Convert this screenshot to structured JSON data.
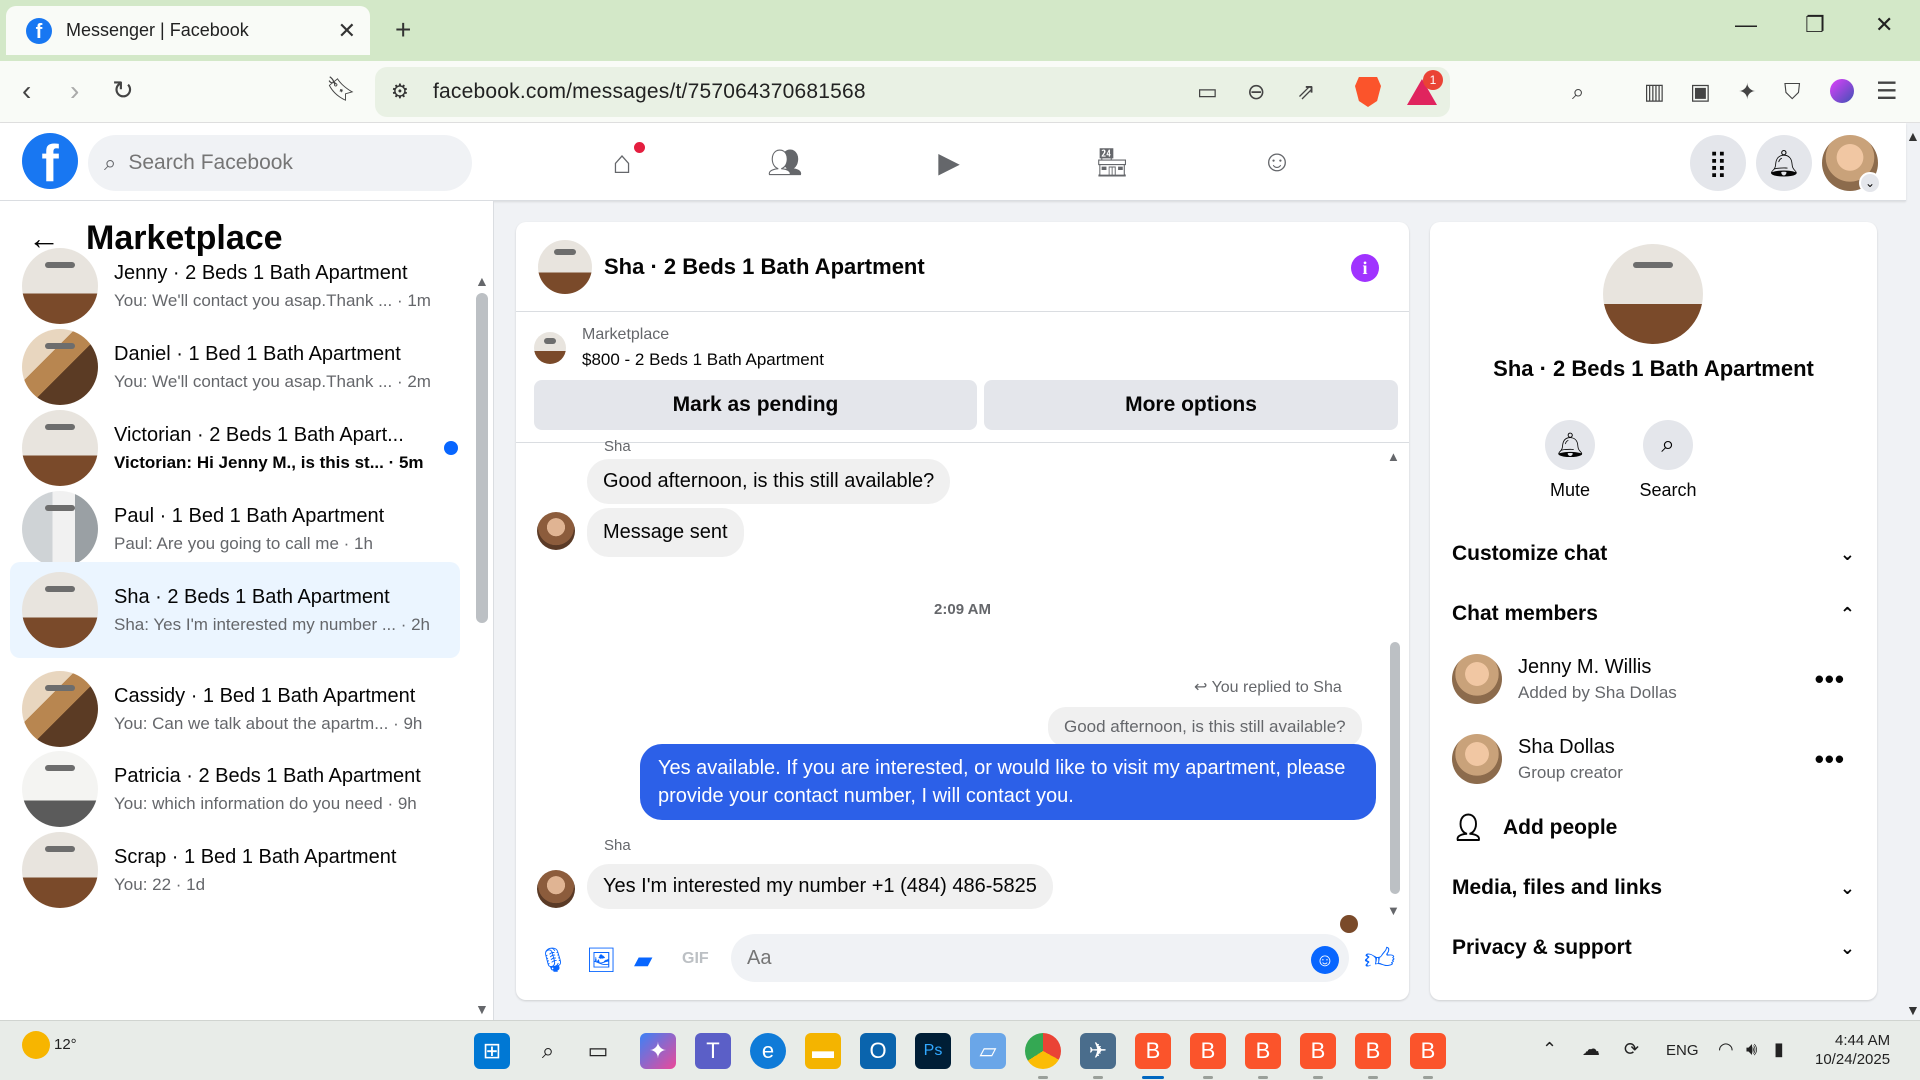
{
  "browser": {
    "tab_title": "Messenger | Facebook",
    "url": "facebook.com/messages/t/757064370681568",
    "brave_badge": "1"
  },
  "fb": {
    "search_placeholder": "Search Facebook",
    "logo_letter": "f"
  },
  "left": {
    "title": "Marketplace",
    "threads": [
      {
        "name": "Jenny · 2 Beds 1 Bath Apartment",
        "preview": "You: We'll contact you asap.Thank ... · 1m",
        "thumb": "room",
        "unread": false,
        "active": false
      },
      {
        "name": "Daniel · 1 Bed 1 Bath Apartment",
        "preview": "You: We'll contact you asap.Thank ... · 2m",
        "thumb": "kitchen",
        "unread": false,
        "active": false
      },
      {
        "name": "Victorian · 2 Beds 1 Bath Apart...",
        "preview": "Victorian: Hi Jenny M., is this st... · 5m",
        "thumb": "room",
        "unread": true,
        "active": false
      },
      {
        "name": "Paul · 1 Bed 1 Bath Apartment",
        "preview": "Paul: Are you going to call me · 1h",
        "thumb": "bath",
        "unread": false,
        "active": false
      },
      {
        "name": "Sha · 2 Beds 1 Bath Apartment",
        "preview": "Sha: Yes I'm interested my number ... · 2h",
        "thumb": "room",
        "unread": false,
        "active": true
      },
      {
        "name": "Cassidy · 1 Bed 1 Bath Apartment",
        "preview": "You: Can we talk about the apartm... · 9h",
        "thumb": "kitchen",
        "unread": false,
        "active": false
      },
      {
        "name": "Patricia · 2 Beds 1 Bath Apartment",
        "preview": "You: which information do you need · 9h",
        "thumb": "white",
        "unread": false,
        "active": false
      },
      {
        "name": "Scrap · 1 Bed 1 Bath Apartment",
        "preview": "You: 22 · 1d",
        "thumb": "room",
        "unread": false,
        "active": false
      }
    ]
  },
  "chat": {
    "title": "Sha · 2 Beds 1 Bath Apartment",
    "marketplace_label": "Marketplace",
    "listing": "$800 - 2 Beds 1 Bath Apartment",
    "mark_pending": "Mark as pending",
    "more_options": "More options",
    "top_sender": "Sha",
    "msg1": "Good afternoon, is this still available?",
    "msg2": "Message sent",
    "timestamp": "2:09 AM",
    "replied_to": "You replied to Sha",
    "quote": "Good afternoon, is this still available?",
    "my_reply": "Yes available. If you are interested, or would like to visit my apartment, please provide your contact number, I will contact you.",
    "sender2": "Sha",
    "msg3": "Yes I'm interested my number +1 (484) 486-5825",
    "composer_placeholder": "Aa"
  },
  "right": {
    "name": "Sha · 2 Beds 1 Bath Apartment",
    "mute": "Mute",
    "search": "Search",
    "customize": "Customize chat",
    "members_title": "Chat members",
    "members": [
      {
        "name": "Jenny M. Willis",
        "sub": "Added by Sha Dollas"
      },
      {
        "name": "Sha Dollas",
        "sub": "Group creator"
      }
    ],
    "add_people": "Add people",
    "media": "Media, files and links",
    "privacy": "Privacy & support"
  },
  "taskbar": {
    "weather": "12°",
    "lang": "ENG",
    "time": "4:44 AM",
    "date": "10/24/2025"
  },
  "colors": {
    "fb_blue": "#1877f2",
    "my_bubble": "#2c60e8",
    "info_purple": "#a033ff",
    "active_thread": "#ebf5ff"
  }
}
